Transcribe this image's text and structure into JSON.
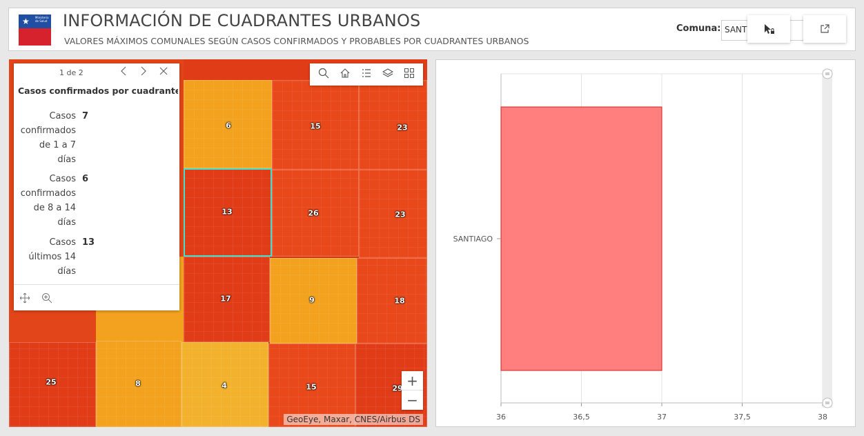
{
  "header": {
    "logo_text": "Ministerio de Salud",
    "title": "INFORMACIÓN DE CUADRANTES URBANOS",
    "subtitle": "VALORES MÁXIMOS COMUNALES SEGÚN CASOS CONFIRMADOS Y PROBABLES POR CUADRANTES URBANOS",
    "comuna_label": "Comuna:",
    "comuna_value": "SANT",
    "buttons": [
      {
        "icon": "selection-cursor-icon"
      },
      {
        "icon": "external-link-icon"
      }
    ]
  },
  "map": {
    "popup": {
      "pager": "1 de 2",
      "title": "Casos confirmados por cuadrante...",
      "fields": [
        {
          "label_lines": [
            "Casos",
            "confirmados",
            "de 1 a 7",
            "días"
          ],
          "value": "7"
        },
        {
          "label_lines": [
            "Casos",
            "confirmados",
            "de 8 a 14",
            "días"
          ],
          "value": "6"
        },
        {
          "label_lines": [
            "Casos",
            "últimos 14",
            "días"
          ],
          "value": "13"
        }
      ]
    },
    "quadrants": [
      {
        "label": "6",
        "color": "#f2a21e"
      },
      {
        "label": "15",
        "color": "#e8481a"
      },
      {
        "label": "23",
        "color": "#e8481a"
      },
      {
        "label": "13",
        "color": "#e03c18"
      },
      {
        "label": "26",
        "color": "#e8481a"
      },
      {
        "label": "23",
        "color": "#e8481a"
      },
      {
        "label": "17",
        "color": "#e03c18"
      },
      {
        "label": "9",
        "color": "#f2a21e"
      },
      {
        "label": "18",
        "color": "#e8481a"
      },
      {
        "label": "25",
        "color": "#e03c18"
      },
      {
        "label": "8",
        "color": "#f2a21e"
      },
      {
        "label": "4",
        "color": "#f2b22e"
      },
      {
        "label": "15",
        "color": "#e8481a"
      },
      {
        "label": "29",
        "color": "#e03c18"
      }
    ],
    "attribution": "GeoEye, Maxar, CNES/Airbus DS",
    "zoom_in": "+",
    "zoom_out": "−"
  },
  "chart_data": {
    "type": "bar",
    "orientation": "horizontal",
    "categories": [
      "SANTIAGO"
    ],
    "values": [
      37
    ],
    "xlim": [
      36,
      38
    ],
    "xticks": [
      "36",
      "36,5",
      "37",
      "37,5",
      "38"
    ],
    "bar_color": "#ff7f7f",
    "bar_stroke": "#d21f1f",
    "grid": true
  }
}
